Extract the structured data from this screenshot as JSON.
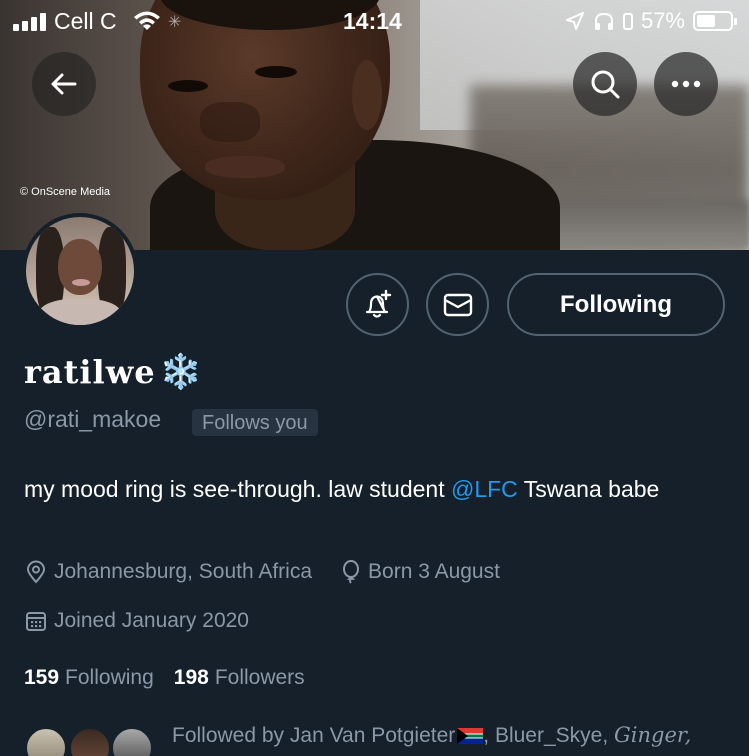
{
  "status_bar": {
    "carrier": "Cell C",
    "time": "14:14",
    "battery": "57%",
    "battery_level": 0.57
  },
  "banner": {
    "credit": "© OnScene Media"
  },
  "header": {
    "back_icon": "arrow-left-icon",
    "search_icon": "search-icon",
    "more_icon": "more-horizontal-icon"
  },
  "actions": {
    "notify_icon": "bell-plus-icon",
    "message_icon": "envelope-icon",
    "following_label": "Following"
  },
  "profile": {
    "display_name": "ratilwe",
    "display_name_emoji": "❄️",
    "handle": "@rati_makoe",
    "follows_you": "Follows you",
    "bio_before": "my mood ring is see-through. law student ",
    "bio_mention": "@LFC",
    "bio_after": " Tswana babe",
    "location": "Johannesburg, South Africa",
    "birthday": "Born 3 August",
    "joined": "Joined January 2020",
    "following_count": "159",
    "following_label": "Following",
    "followers_count": "198",
    "followers_label": "Followers",
    "followed_by_prefix": "Followed by Jan Van Potgieter",
    "followed_by_rest": ", Bluer_Skye, ",
    "followed_by_ginger": "Ginger,"
  },
  "colors": {
    "background": "#15202b",
    "accent": "#1d9bf0",
    "secondary_text": "#8b98a5",
    "border": "#536471"
  }
}
